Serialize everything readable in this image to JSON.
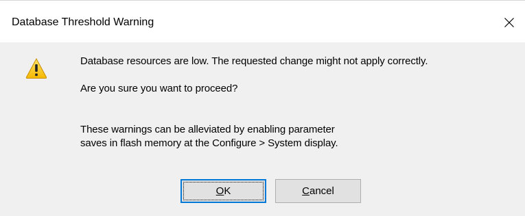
{
  "window": {
    "title": "Database Threshold Warning"
  },
  "message": {
    "line1": "Database resources are low. The requested change might not apply correctly.",
    "line2": "Are you sure you want to proceed?",
    "line3": "These warnings can be alleviated by enabling parameter",
    "line4": "saves in flash memory at the Configure > System display."
  },
  "buttons": {
    "ok": {
      "mnemonic": "O",
      "rest": "K"
    },
    "cancel": {
      "mnemonic": "C",
      "rest": "ancel"
    }
  },
  "icons": {
    "warning": "warning-triangle-icon",
    "close": "close-x-icon"
  },
  "colors": {
    "title_bg": "#ffffff",
    "body_bg": "#f0f0f0",
    "default_button_border": "#0078d7",
    "warning_yellow": "#ffd43b"
  }
}
